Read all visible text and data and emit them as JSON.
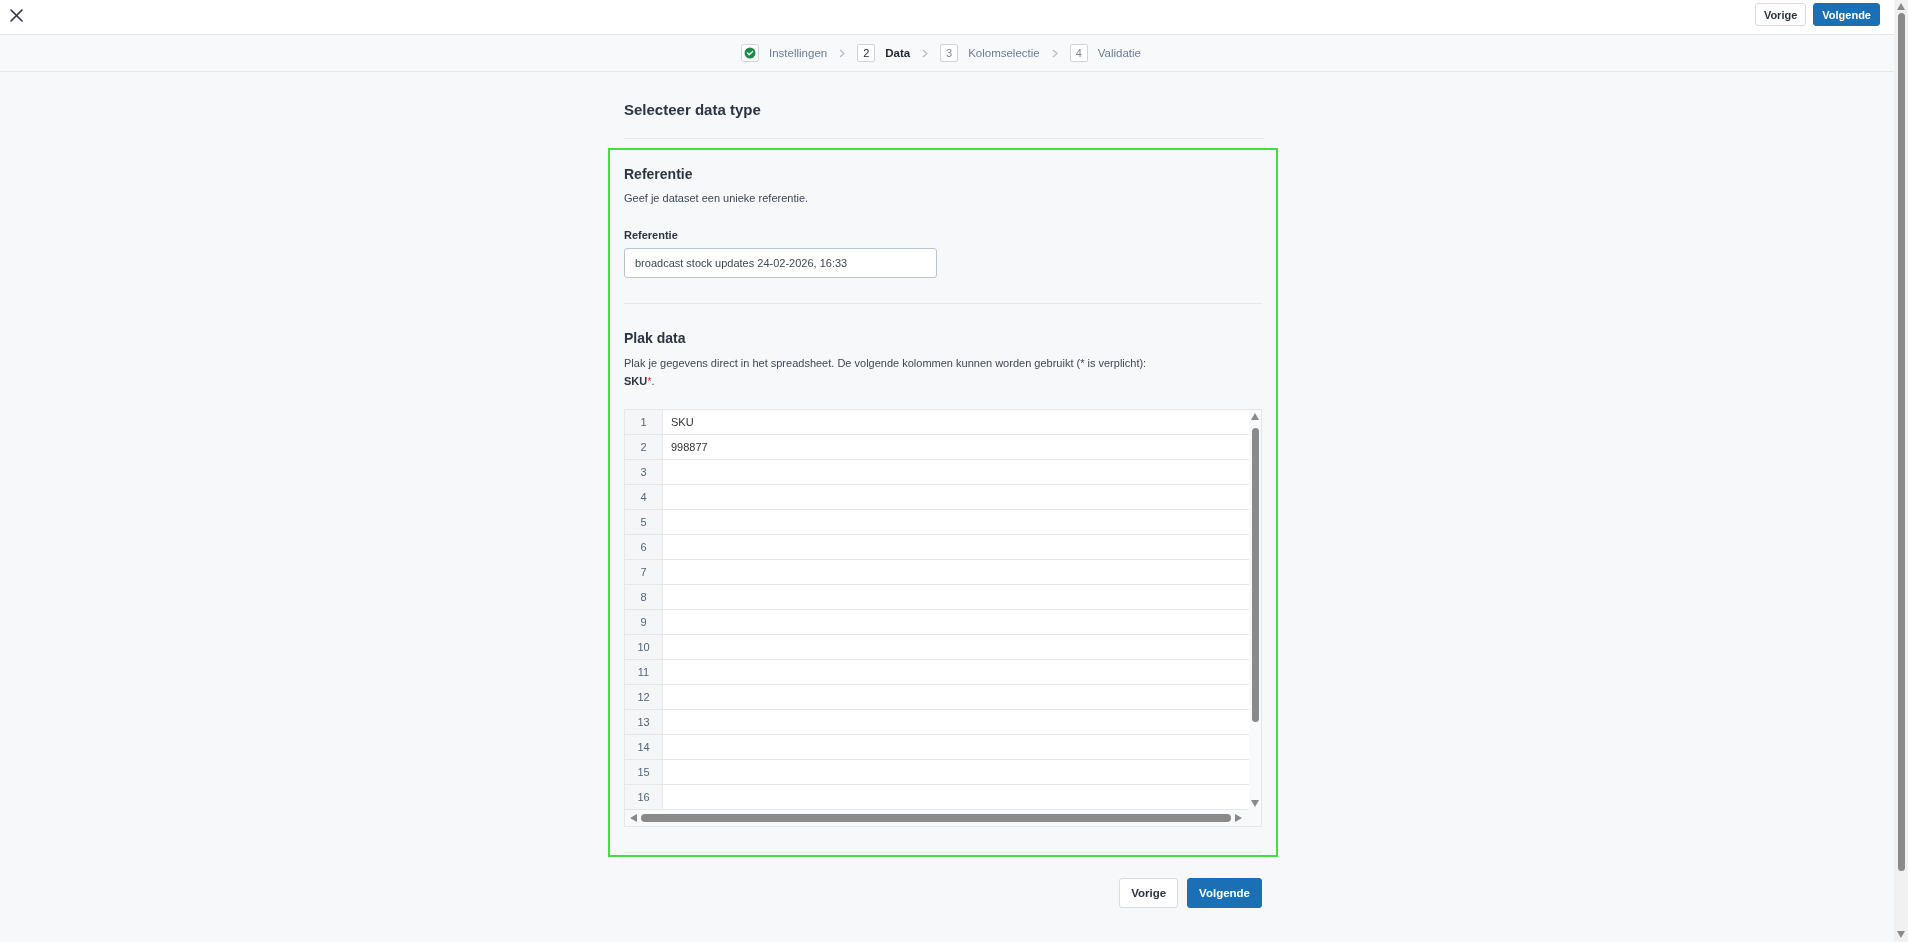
{
  "header": {
    "buttons": [
      {
        "label": "Vorige",
        "kind": "secondary"
      },
      {
        "label": "Volgende",
        "kind": "primary"
      }
    ]
  },
  "stepper": {
    "steps": [
      {
        "label": "Instellingen",
        "completed": true,
        "selected": false
      },
      {
        "number": "2",
        "label": "Data",
        "completed": false,
        "selected": true
      },
      {
        "number": "3",
        "label": "Kolomselectie",
        "completed": false,
        "selected": false
      },
      {
        "number": "4",
        "label": "Validatie",
        "completed": false,
        "selected": false
      }
    ]
  },
  "page": {
    "title": "Selecteer data type"
  },
  "reference": {
    "title": "Referentie",
    "description": "Geef je dataset een unieke referentie.",
    "field": {
      "label": "Referentie",
      "value": "broadcast stock updates 24-02-2026, 16:33"
    }
  },
  "paste_data": {
    "title": "Plak data",
    "description": "Plak je gegevens direct in het spreadsheet. De volgende kolommen kunnen worden gebruikt (* is verplicht):",
    "columns": [
      {
        "name": "SKU",
        "required": true
      }
    ],
    "required_mark": "*",
    "list_end": "."
  },
  "spreadsheet": {
    "rows": [
      {
        "number": "1",
        "value": "SKU"
      },
      {
        "number": "2",
        "value": "998877"
      },
      {
        "number": "3"
      },
      {
        "number": "4"
      },
      {
        "number": "5"
      },
      {
        "number": "6"
      },
      {
        "number": "7"
      },
      {
        "number": "8"
      },
      {
        "number": "9"
      },
      {
        "number": "10"
      },
      {
        "number": "11"
      },
      {
        "number": "12"
      },
      {
        "number": "13"
      },
      {
        "number": "14"
      },
      {
        "number": "15"
      },
      {
        "number": "16"
      }
    ]
  },
  "footer": {
    "buttons": [
      {
        "label": "Vorige",
        "kind": "secondary"
      },
      {
        "label": "Volgende",
        "kind": "primary"
      }
    ]
  }
}
